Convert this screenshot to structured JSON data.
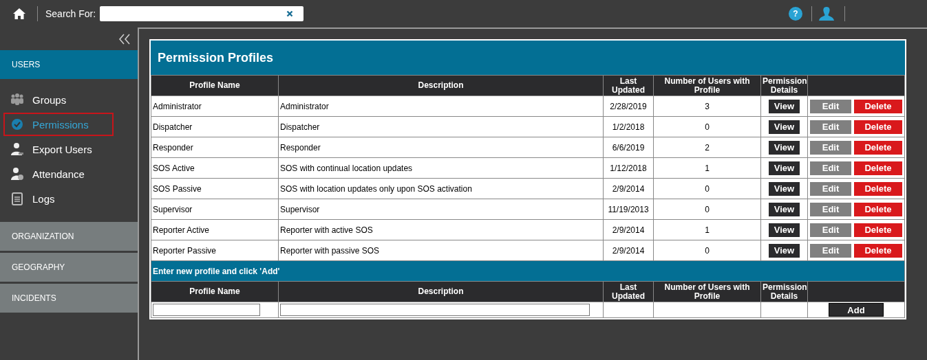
{
  "topbar": {
    "search_label": "Search For:",
    "help_label": "?"
  },
  "sidebar": {
    "sections": [
      {
        "label": "USERS",
        "selected": true,
        "items": [
          {
            "label": "Groups",
            "selected": false
          },
          {
            "label": "Permissions",
            "selected": true
          },
          {
            "label": "Export Users",
            "selected": false
          },
          {
            "label": "Attendance",
            "selected": false
          },
          {
            "label": "Logs",
            "selected": false
          }
        ]
      },
      {
        "label": "ORGANIZATION",
        "selected": false
      },
      {
        "label": "GEOGRAPHY",
        "selected": false
      },
      {
        "label": "INCIDENTS",
        "selected": false
      }
    ]
  },
  "panel": {
    "title": "Permission Profiles",
    "columns": [
      "Profile Name",
      "Description",
      "Last Updated",
      "Number of Users with Profile",
      "Permission Details"
    ],
    "rows": [
      {
        "name": "Administrator",
        "description": "Administrator",
        "updated": "2/28/2019",
        "users": "3",
        "view": "View",
        "edit": "Edit",
        "delete": "Delete"
      },
      {
        "name": "Dispatcher",
        "description": "Dispatcher",
        "updated": "1/2/2018",
        "users": "0",
        "view": "View",
        "edit": "Edit",
        "delete": "Delete"
      },
      {
        "name": "Responder",
        "description": "Responder",
        "updated": "6/6/2019",
        "users": "2",
        "view": "View",
        "edit": "Edit",
        "delete": "Delete"
      },
      {
        "name": "SOS Active",
        "description": "SOS with continual location updates",
        "updated": "1/12/2018",
        "users": "1",
        "view": "View",
        "edit": "Edit",
        "delete": "Delete"
      },
      {
        "name": "SOS Passive",
        "description": "SOS with location updates only upon SOS activation",
        "updated": "2/9/2014",
        "users": "0",
        "view": "View",
        "edit": "Edit",
        "delete": "Delete"
      },
      {
        "name": "Supervisor",
        "description": "Supervisor",
        "updated": "11/19/2013",
        "users": "0",
        "view": "View",
        "edit": "Edit",
        "delete": "Delete"
      },
      {
        "name": "Reporter Active",
        "description": "Reporter with active SOS",
        "updated": "2/9/2014",
        "users": "1",
        "view": "View",
        "edit": "Edit",
        "delete": "Delete"
      },
      {
        "name": "Reporter Passive",
        "description": "Reporter with passive SOS",
        "updated": "2/9/2014",
        "users": "0",
        "view": "View",
        "edit": "Edit",
        "delete": "Delete"
      }
    ],
    "add_title": "Enter new profile and click 'Add'",
    "add_columns": [
      "Profile Name",
      "Description",
      "Last Updated",
      "Number of Users with Profile",
      "Permission Details"
    ],
    "add_label": "Add"
  }
}
